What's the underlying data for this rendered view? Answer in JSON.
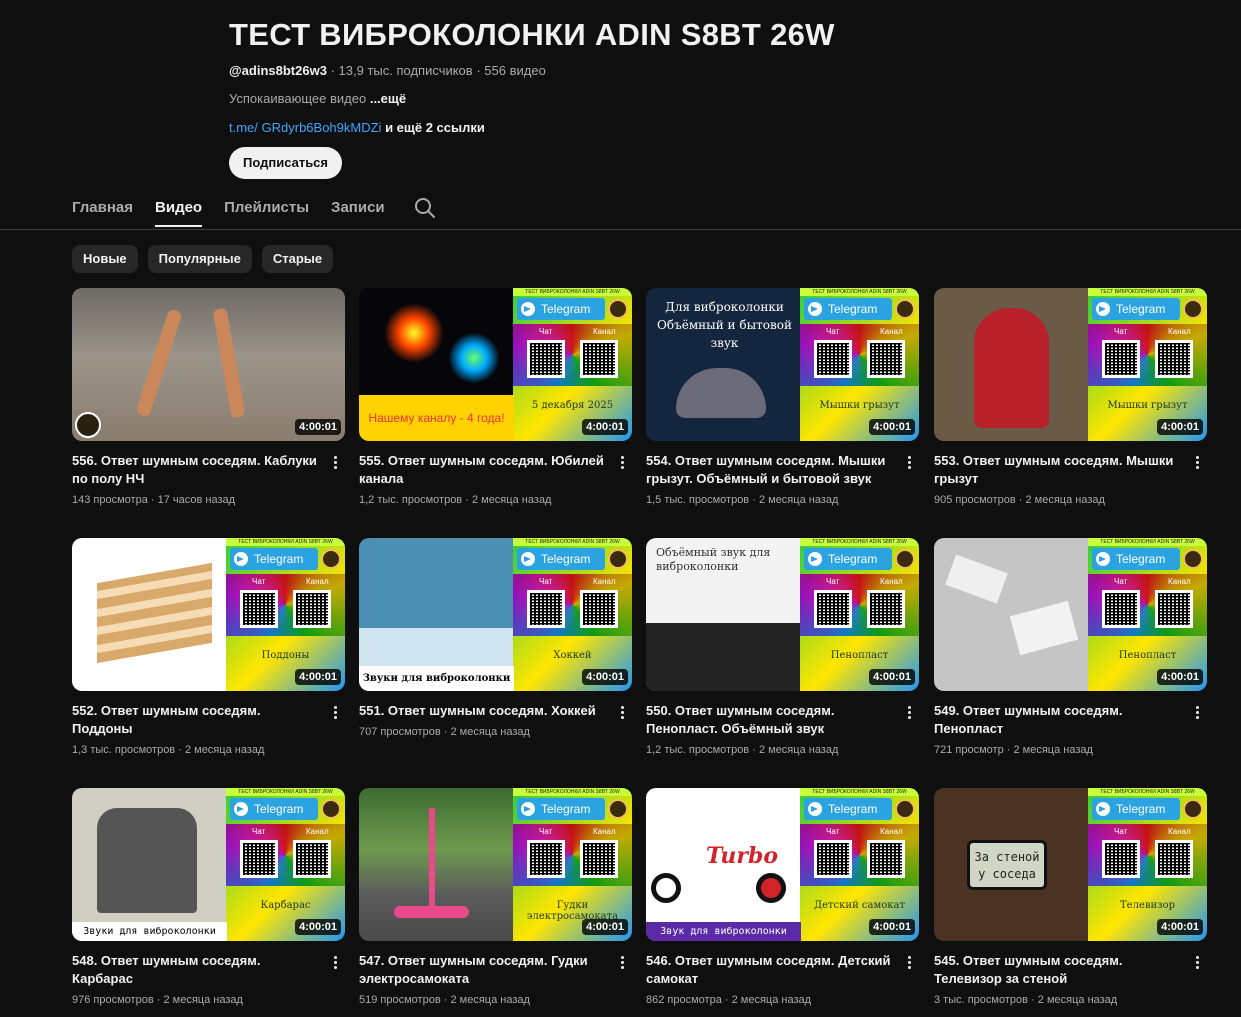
{
  "channel": {
    "title": "ТЕСТ ВИБРОКОЛОНКИ ADIN S8BT 26W",
    "handle": "@adins8bt26w3",
    "subscribers": "13,9 тыс. подписчиков",
    "video_count": "556 видео",
    "separator": "·",
    "description": "Успокаивающее видео",
    "more": "...ещё",
    "link": "t.me/ GRdyrb6Boh9kMDZi",
    "more_links": "и ещё 2 ссылки",
    "subscribe_label": "Подписаться"
  },
  "tabs": [
    {
      "label": "Главная",
      "active": false
    },
    {
      "label": "Видео",
      "active": true
    },
    {
      "label": "Плейлисты",
      "active": false
    },
    {
      "label": "Записи",
      "active": false
    }
  ],
  "chips": [
    "Новые",
    "Популярные",
    "Старые"
  ],
  "thumb_common": {
    "channel_banner": "ТЕСТ ВИБРОКОЛОНКИ ADIN S8BT 26W",
    "telegram": "Telegram",
    "chat": "Чат",
    "channel": "Канал"
  },
  "videos": [
    {
      "title": "556. Ответ шумным соседям. Каблуки по полу НЧ",
      "views": "143 просмотра",
      "age": "17 часов назад",
      "duration": "4:00:01",
      "scene": "legs",
      "panel": false,
      "caption": "",
      "label": ""
    },
    {
      "title": "555. Ответ шумным соседям. Юбилей канала",
      "views": "1,2 тыс. просмотров",
      "age": "2 месяца назад",
      "duration": "4:00:01",
      "scene": "fireworks",
      "panel": true,
      "caption": "5 декабря 2025",
      "label": "Нашему каналу - 4 года!"
    },
    {
      "title": "554. Ответ шумным соседям. Мышки грызут. Объёмный и бытовой звук",
      "views": "1,5 тыс. просмотров",
      "age": "2 месяца назад",
      "duration": "4:00:01",
      "scene": "mice",
      "panel": true,
      "caption": "Мышки грызут",
      "label": "Для виброколонки Объёмный и бытовой звук"
    },
    {
      "title": "553. Ответ шумным соседям. Мышки грызут",
      "views": "905 просмотров",
      "age": "2 месяца назад",
      "duration": "4:00:01",
      "scene": "king",
      "panel": true,
      "caption": "Мышки грызут",
      "label": ""
    },
    {
      "title": "552. Ответ шумным соседям. Поддоны",
      "views": "1,3 тыс. просмотров",
      "age": "2 месяца назад",
      "duration": "4:00:01",
      "scene": "white",
      "panel": true,
      "caption": "Поддоны",
      "label": ""
    },
    {
      "title": "551. Ответ шумным соседям. Хоккей",
      "views": "707 просмотров",
      "age": "2 месяца назад",
      "duration": "4:00:01",
      "scene": "hockey",
      "panel": true,
      "caption": "Хоккей",
      "label": "Звуки для виброколонки"
    },
    {
      "title": "550. Ответ шумным соседям. Пенопласт. Объёмный звук",
      "views": "1,2 тыс. просмотров",
      "age": "2 месяца назад",
      "duration": "4:00:01",
      "scene": "foam",
      "panel": true,
      "caption": "Пенопласт",
      "label": "Объёмный звук для виброколонки"
    },
    {
      "title": "549. Ответ шумным соседям. Пенопласт",
      "views": "721 просмотр",
      "age": "2 месяца назад",
      "duration": "4:00:01",
      "scene": "bricks",
      "panel": true,
      "caption": "Пенопласт",
      "label": ""
    },
    {
      "title": "548. Ответ шумным соседям. Карбарас",
      "views": "976 просмотров",
      "age": "2 месяца назад",
      "duration": "4:00:01",
      "scene": "ruins",
      "panel": true,
      "caption": "Карбарас",
      "label": "Звуки для виброколонки"
    },
    {
      "title": "547. Ответ шумным соседям. Гудки электросамоката",
      "views": "519 просмотров",
      "age": "2 месяца назад",
      "duration": "4:00:01",
      "scene": "road",
      "panel": true,
      "caption": "Гудки электросамоката",
      "label": ""
    },
    {
      "title": "546. Ответ шумным соседям. Детский самокат",
      "views": "862 просмотра",
      "age": "2 месяца назад",
      "duration": "4:00:01",
      "scene": "scooter",
      "panel": true,
      "caption": "Детский самокат",
      "label": "Звук для виброколонки"
    },
    {
      "title": "545. Ответ шумным соседям. Телевизор за стеной",
      "views": "3 тыс. просмотров",
      "age": "2 месяца назад",
      "duration": "4:00:01",
      "scene": "tv",
      "panel": true,
      "caption": "Телевизор",
      "label": "За стеной у соседа"
    }
  ],
  "colors": {
    "background": "#0f0f0f",
    "link": "#3ea6ff",
    "chip": "#272727",
    "subscribe_bg": "#f1f1f1"
  }
}
